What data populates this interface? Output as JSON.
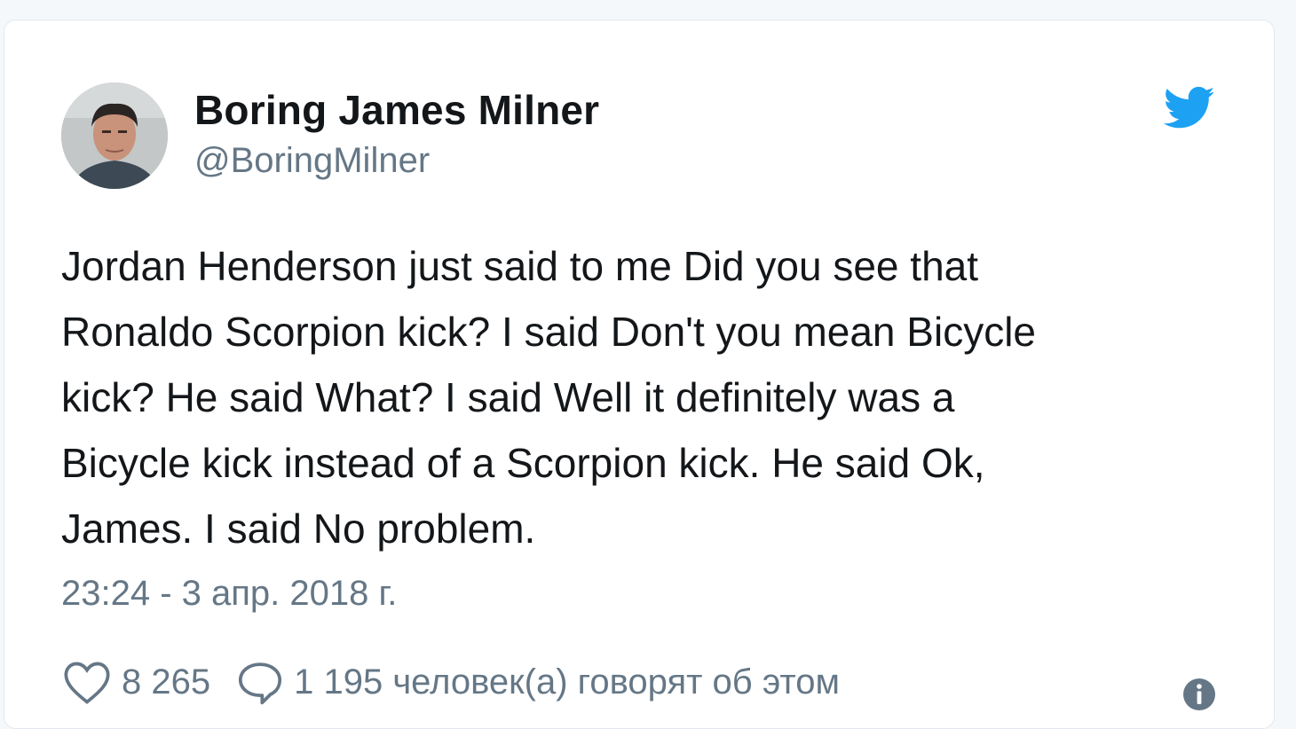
{
  "tweet": {
    "author_name": "Boring James Milner",
    "author_handle": "@BoringMilner",
    "text": "Jordan Henderson just said to me Did you see that\nRonaldo Scorpion kick? I said Don't you mean Bicycle\nkick? He said What? I said Well it definitely was a\nBicycle kick instead of a Scorpion kick. He said Ok,\nJames. I said No problem.",
    "timestamp": "23:24 - 3 апр. 2018 г.",
    "likes": "8 265",
    "replies_text": "1 195 человек(а) говорят об этом"
  },
  "icons": {
    "brand": "twitter-bird-icon",
    "like": "heart-icon",
    "reply": "speech-bubble-icon",
    "info": "info-icon"
  },
  "colors": {
    "brand": "#1da1f2",
    "text": "#14171a",
    "secondary": "#657786",
    "border": "#e1e8ed"
  }
}
